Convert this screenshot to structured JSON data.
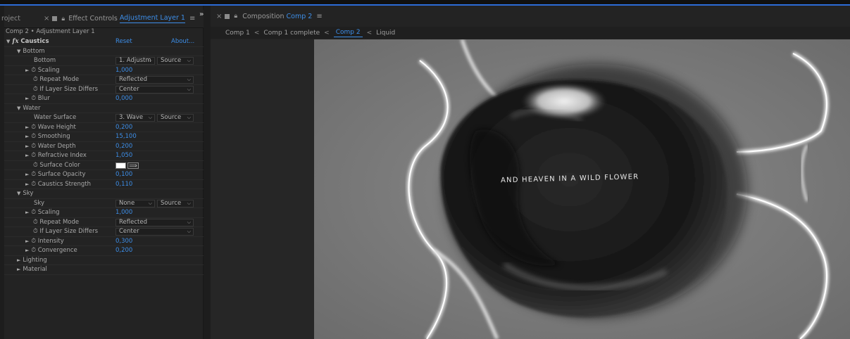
{
  "left_tabs": {
    "project_label": "roject",
    "close_glyph": "×",
    "effect_controls_label": "Effect Controls",
    "layer_name": "Adjustment Layer 1",
    "menu_glyph": "≡",
    "overflow_glyph": "»"
  },
  "effect_controls": {
    "header": "Comp 2 • Adjustment Layer 1",
    "effect_name": "Caustics",
    "reset_label": "Reset",
    "about_label": "About...",
    "bottom_group": {
      "label": "Bottom",
      "bottom_label": "Bottom",
      "bottom_layer": "1. Adjustm",
      "bottom_source": "Source",
      "scaling_label": "Scaling",
      "scaling_value": "1,000",
      "repeat_mode_label": "Repeat Mode",
      "repeat_mode_value": "Reflected",
      "if_layer_label": "If Layer Size Differs",
      "if_layer_value": "Center",
      "blur_label": "Blur",
      "blur_value": "0,000"
    },
    "water_group": {
      "label": "Water",
      "surface_label": "Water Surface",
      "surface_layer": "3. Wave",
      "surface_source": "Source",
      "wave_height_label": "Wave Height",
      "wave_height_value": "0,200",
      "smoothing_label": "Smoothing",
      "smoothing_value": "15,100",
      "water_depth_label": "Water Depth",
      "water_depth_value": "0,200",
      "refractive_label": "Refractive Index",
      "refractive_value": "1,050",
      "surface_color_label": "Surface Color",
      "surface_color": "#ffffff",
      "surface_opacity_label": "Surface Opacity",
      "surface_opacity_value": "0,100",
      "caustics_strength_label": "Caustics Strength",
      "caustics_strength_value": "0,110"
    },
    "sky_group": {
      "label": "Sky",
      "sky_label": "Sky",
      "sky_layer": "None",
      "sky_source": "Source",
      "scaling_label": "Scaling",
      "scaling_value": "1,000",
      "repeat_mode_label": "Repeat Mode",
      "repeat_mode_value": "Reflected",
      "if_layer_label": "If Layer Size Differs",
      "if_layer_value": "Center",
      "intensity_label": "Intensity",
      "intensity_value": "0,300",
      "convergence_label": "Convergence",
      "convergence_value": "0,200"
    },
    "lighting_label": "Lighting",
    "material_label": "Material"
  },
  "comp_panel": {
    "close_glyph": "×",
    "title": "Composition",
    "comp_name": "Comp 2",
    "menu_glyph": "≡",
    "breadcrumbs": [
      "Comp 1",
      "Comp 1 complete",
      "Comp 2",
      "Liquid"
    ],
    "separator": "<",
    "comp_text": "AND HEAVEN IN A WILD FLOWER"
  },
  "colors": {
    "accent": "#3d8ee8",
    "panel_bg": "#232323",
    "value_blue": "#3d8ee8"
  }
}
